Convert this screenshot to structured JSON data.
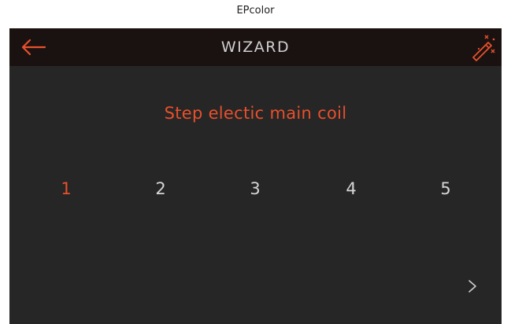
{
  "window_caption": "EPcolor",
  "header": {
    "title": "WIZARD",
    "back_icon": "arrow-left-icon",
    "wizard_icon": "magic-wand-icon"
  },
  "step_title": "Step electic main coil",
  "steps": [
    {
      "label": "1",
      "active": true
    },
    {
      "label": "2",
      "active": false
    },
    {
      "label": "3",
      "active": false
    },
    {
      "label": "4",
      "active": false
    },
    {
      "label": "5",
      "active": false
    }
  ],
  "next_icon": "chevron-right-icon",
  "colors": {
    "accent": "#e8502c",
    "background": "#262626",
    "header_background": "#1a1211",
    "text": "#d6d6d6"
  }
}
